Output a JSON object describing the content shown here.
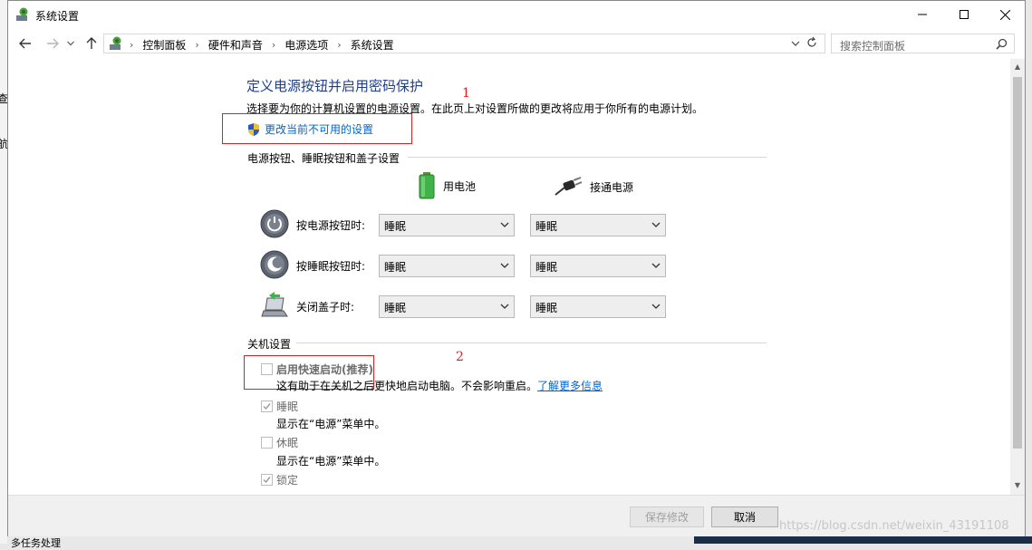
{
  "window": {
    "title": "系统设置"
  },
  "breadcrumbs": [
    "控制面板",
    "硬件和声音",
    "电源选项",
    "系统设置"
  ],
  "search": {
    "placeholder": "搜索控制面板"
  },
  "main": {
    "heading": "定义电源按钮并启用密码保护",
    "description": "选择要为你的计算机设置的电源设置。在此页上对设置所做的更改将应用于你所有的电源计划。",
    "change_link": "更改当前不可用的设置",
    "power_section": {
      "title": "电源按钮、睡眠按钮和盖子设置",
      "col_battery": "用电池",
      "col_plugged": "接通电源",
      "rows": [
        {
          "label": "按电源按钮时:",
          "battery": "睡眠",
          "plugged": "睡眠"
        },
        {
          "label": "按睡眠按钮时:",
          "battery": "睡眠",
          "plugged": "睡眠"
        },
        {
          "label": "关闭盖子时:",
          "battery": "睡眠",
          "plugged": "睡眠"
        }
      ]
    },
    "shutdown_section": {
      "title": "关机设置",
      "fast_startup": {
        "label": "启用快速启动(推荐)",
        "desc": "这有助于在关机之后更快地启动电脑。不会影响重启。",
        "link": "了解更多信息",
        "checked": false
      },
      "sleep": {
        "label": "睡眠",
        "desc": "显示在“电源”菜单中。",
        "checked": true
      },
      "hibernate": {
        "label": "休眠",
        "desc": "显示在“电源”菜单中。",
        "checked": false
      },
      "lock": {
        "label": "锁定",
        "checked": true
      }
    }
  },
  "annotations": {
    "one": "1",
    "two": "2"
  },
  "footer": {
    "save": "保存修改",
    "cancel": "取消"
  },
  "background": {
    "left_text_1": "查",
    "left_text_2": "航",
    "left_text_3": "多任务处理"
  },
  "watermark": "https://blog.csdn.net/weixin_43191108",
  "colors": {
    "heading": "#1e3f8c",
    "link": "#0066cc",
    "annotation": "#e02020"
  }
}
